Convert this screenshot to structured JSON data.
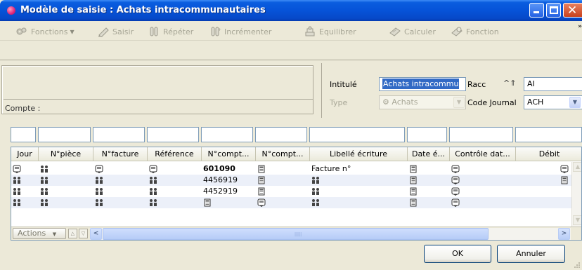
{
  "window": {
    "title": "Modèle de saisie : Achats intracommunautaires"
  },
  "toolbar": {
    "items": [
      {
        "label": "Fonctions",
        "icon": "gears-icon"
      },
      {
        "label": "Saisir",
        "icon": "pencil-icon"
      },
      {
        "label": "Répéter",
        "icon": "repeat-icon"
      },
      {
        "label": "Incrémenter",
        "icon": "increment-icon"
      },
      {
        "label": "Equilibrer",
        "icon": "balance-icon"
      },
      {
        "label": "Calculer",
        "icon": "calculator-icon"
      },
      {
        "label": "Fonction",
        "icon": "function-icon"
      }
    ],
    "more": "»"
  },
  "form": {
    "compte_label": "Compte :",
    "intitule_label": "Intitulé",
    "intitule_value": "Achats intracommu",
    "racc_label": "Racc",
    "racc_value": "AI",
    "type_label": "Type",
    "type_value": "Achats",
    "code_journal_label": "Code Journal",
    "code_journal_value": "ACH"
  },
  "grid": {
    "columns": [
      "Jour",
      "N°pièce",
      "N°facture",
      "Référence",
      "N°compt...",
      "N°compt...",
      "Libellé écriture",
      "Date é...",
      "Contrôle dat...",
      "Débit"
    ],
    "rows": [
      {
        "cells": [
          "[i]",
          "[u]",
          "[i]",
          "[i]",
          "601090",
          "[c]",
          "Facture n°",
          "[c]",
          "[i]",
          "[i]"
        ],
        "bold": true
      },
      {
        "cells": [
          "[u]",
          "[u]",
          "[u]",
          "[u]",
          "4456919",
          "[c]",
          "[u]",
          "[c]",
          "[i]",
          "[c]"
        ],
        "bold": false
      },
      {
        "cells": [
          "[u]",
          "[u]",
          "[u]",
          "[u]",
          "4452919",
          "[c]",
          "[u]",
          "[c]",
          "[i]",
          ""
        ],
        "bold": false
      },
      {
        "cells": [
          "[u]",
          "[u]",
          "[u]",
          "[u]",
          "[c]",
          "[i]",
          "[u]",
          "[c]",
          "[i]",
          ""
        ],
        "bold": false
      }
    ],
    "actions_label": "Actions"
  },
  "buttons": {
    "ok": "OK",
    "cancel": "Annuler"
  },
  "colors": {
    "titlebar": "#0653d8",
    "selection": "#316ac5",
    "row_alt": "#ecf0f9",
    "disabled_text": "#a7a696"
  }
}
